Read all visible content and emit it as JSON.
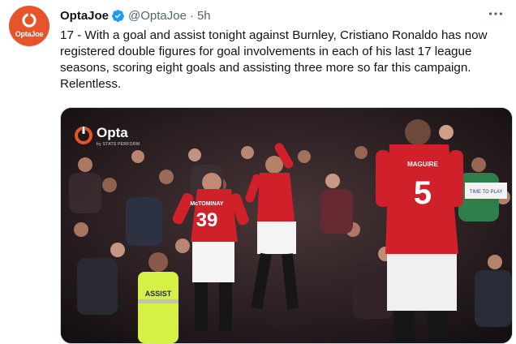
{
  "account": {
    "display_name": "OptaJoe",
    "handle": "@OptaJoe",
    "separator": "·",
    "timestamp": "5h",
    "avatar_brand": "Opta",
    "avatar_suffix": "Joe",
    "verified": true
  },
  "tweet": {
    "text": "17 - With a goal and assist tonight against Burnley, Cristiano Ronaldo has now registered double figures for goal involvements in each of his last 17 league seasons, scoring eight goals and assisting three more so far this campaign. Relentless."
  },
  "media": {
    "logo_text": "Opta",
    "logo_subtext": "by STATS PERFORM",
    "player_left_number": "39",
    "player_left_name": "McTOMINAY",
    "player_right_number": "5",
    "player_right_name": "MAGUIRE",
    "steward_vest_text": "ASSIST",
    "banner_text": "TIME TO PLAY"
  },
  "colors": {
    "avatar_bg": "#e8542a",
    "verified_blue": "#1d9bf0",
    "text_primary": "#0f1419",
    "text_secondary": "#536471",
    "kit_red": "#d0202a",
    "hi_vis": "#d6f046"
  },
  "icons": [
    "verified-badge-icon",
    "more-options-icon",
    "opta-logo-mark-icon"
  ]
}
